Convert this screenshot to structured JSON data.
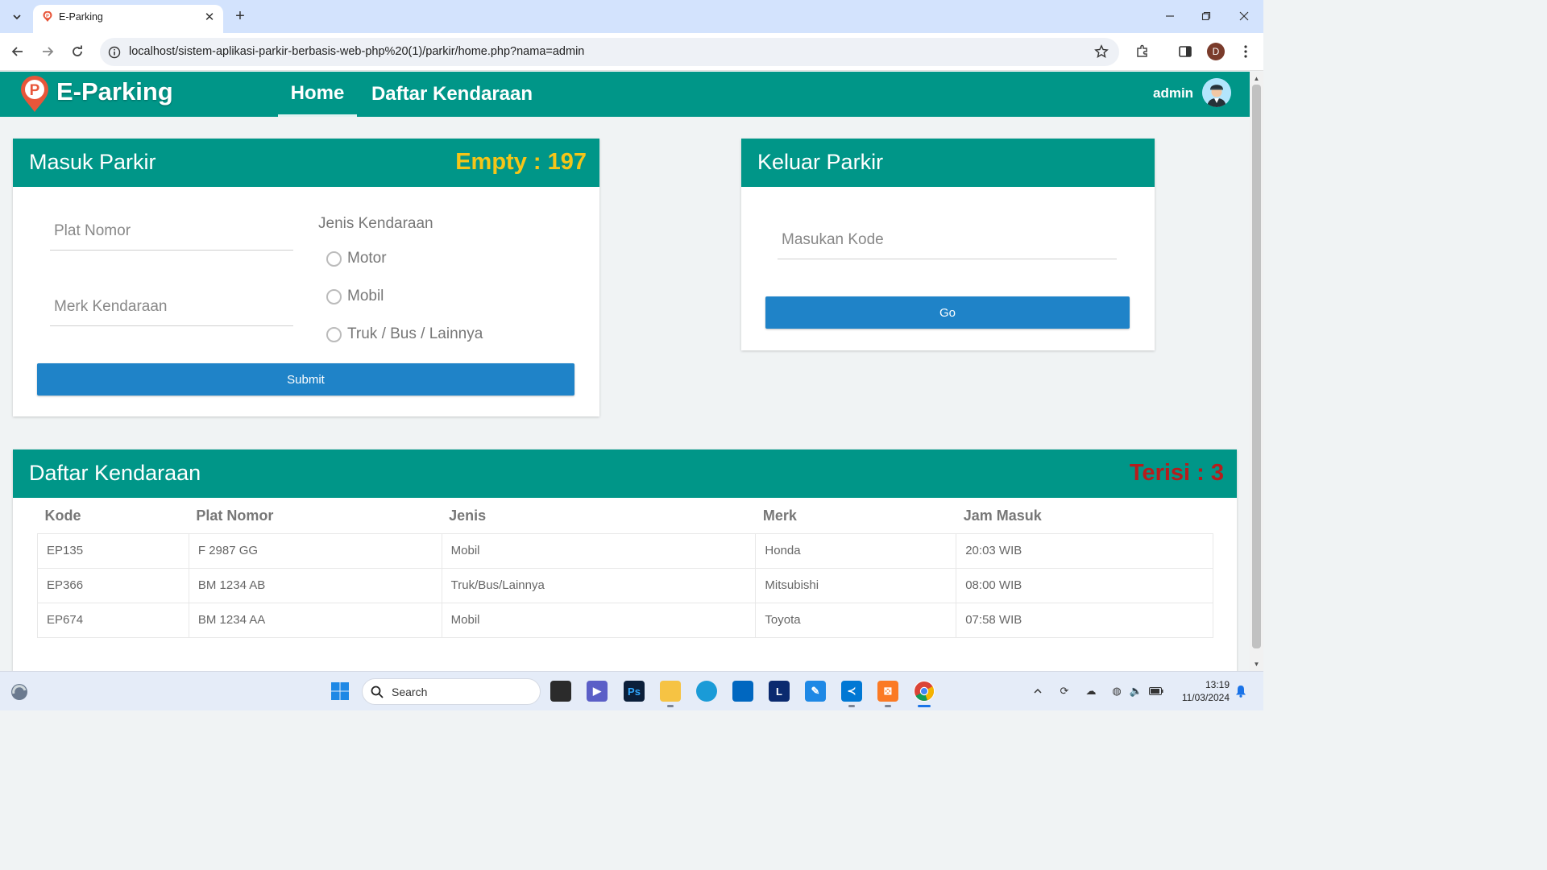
{
  "browser": {
    "tab_title": "E-Parking",
    "url": "localhost/sistem-aplikasi-parkir-berbasis-web-php%20(1)/parkir/home.php?nama=admin",
    "profile_initial": "D"
  },
  "navbar": {
    "brand": "E-Parking",
    "links": [
      "Home",
      "Daftar Kendaraan"
    ],
    "active_link": "Home",
    "user": "admin"
  },
  "masuk": {
    "title": "Masuk Parkir",
    "counter": "Empty : 197",
    "counter_color": "#f5c518",
    "plat_placeholder": "Plat Nomor",
    "merk_placeholder": "Merk Kendaraan",
    "jenis_label": "Jenis Kendaraan",
    "options": [
      "Motor",
      "Mobil",
      "Truk / Bus / Lainnya"
    ],
    "submit": "Submit"
  },
  "keluar": {
    "title": "Keluar Parkir",
    "kode_placeholder": "Masukan Kode",
    "go": "Go"
  },
  "daftar": {
    "title": "Daftar Kendaraan",
    "counter": "Terisi : 3",
    "counter_color": "#b71c1c",
    "columns": [
      "Kode",
      "Plat Nomor",
      "Jenis",
      "Merk",
      "Jam Masuk"
    ],
    "rows": [
      [
        "EP135",
        "F 2987 GG",
        "Mobil",
        "Honda",
        "20:03 WIB"
      ],
      [
        "EP366",
        "BM 1234 AB",
        "Truk/Bus/Lainnya",
        "Mitsubishi",
        "08:00 WIB"
      ],
      [
        "EP674",
        "BM 1234 AA",
        "Mobil",
        "Toyota",
        "07:58 WIB"
      ]
    ]
  },
  "taskbar": {
    "search_placeholder": "Search",
    "time": "13:19",
    "date": "11/03/2024"
  },
  "colors": {
    "primary": "#009688",
    "button": "#1f83c8"
  }
}
